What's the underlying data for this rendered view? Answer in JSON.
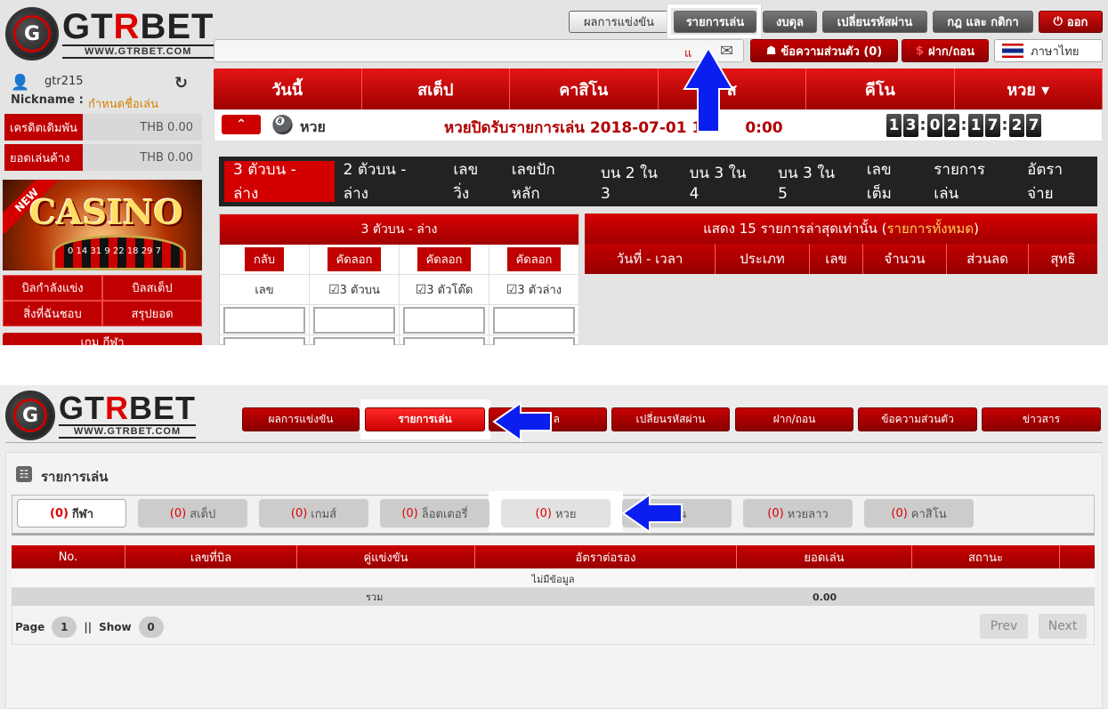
{
  "top": {
    "logo": {
      "name_a": "GT",
      "name_b": "R",
      "name_c": "BET",
      "url": "WWW.GTRBET.COM",
      "mark": "G"
    },
    "header_buttons": {
      "results": "ผลการแข่งขัน",
      "bets": "รายการเล่น",
      "balance": "งบดุล",
      "change_password": "เปลี่ยนรหัสผ่าน",
      "rules": "กฎ และ กติกา",
      "logout": "ออก"
    },
    "marquee_text": "แ",
    "messages": "ข้อความส่วนตัว (0)",
    "deposit": "ฝาก/ถอน",
    "language": "ภาษาไทย",
    "user": {
      "username": "gtr215",
      "nickname_label": "Nickname :",
      "nickname_value": "กำหนดชื่อเล่น"
    },
    "credit": {
      "label": "เครดิตเดิมพัน",
      "value": "THB 0.00"
    },
    "outstanding": {
      "label": "ยอดเล่นค้าง",
      "value": "THB 0.00"
    },
    "casino_banner": {
      "badge": "NEW",
      "text": "CASINO",
      "wheel_numbers": "0 14 31 9 22 18 29 7"
    },
    "side_menu": [
      "บิลกำลังแข่ง",
      "บิลสเต็ป",
      "สิ่งที่ฉันชอบ",
      "สรุปยอด"
    ],
    "side_bottom": "เกม กีฬา",
    "main_nav": [
      "วันนี้",
      "สเต็ป",
      "คาสิโน",
      "ส",
      "คีโน",
      "หวย ▾"
    ],
    "lotto_label": "หวย",
    "close_text": "หวยปิดรับรายการเล่น 2018-07-01 1",
    "close_time_tail": "0:00",
    "countdown": [
      "1",
      "3",
      ":",
      "0",
      "2",
      ":",
      "1",
      "7",
      ":",
      "2",
      "7"
    ],
    "lotto_tabs": [
      "3 ตัวบน - ล่าง",
      "2 ตัวบน - ล่าง",
      "เลขวิ่ง",
      "เลขปักหลัก",
      "บน 2 ใน 3",
      "บน 3 ใน 4",
      "บน 3 ใน 5",
      "เลขเต็ม",
      "รายการเล่น",
      "อัตราจ่าย"
    ],
    "form": {
      "title": "3 ตัวบน - ล่าง",
      "buttons": [
        "กลับ",
        "คัดลอก",
        "คัดลอก",
        "คัดลอก"
      ],
      "number_label": "เลข",
      "checks": [
        "3 ตัวบน",
        "3 ตัวโต๊ด",
        "3 ตัวล่าง"
      ]
    },
    "recent": {
      "title": "แสดง 15 รายการล่าสุดเท่านั้น (",
      "link": "รายการทั้งหมด",
      "title_end": ")",
      "columns": [
        "วันที่ - เวลา",
        "ประเภท",
        "เลข",
        "จำนวน",
        "ส่วนลด",
        "สุทธิ"
      ]
    }
  },
  "bottom": {
    "nav": [
      "ผลการแข่งขัน",
      "รายการเล่น",
      "ล",
      "เปลี่ยนรหัสผ่าน",
      "ฝาก/ถอน",
      "ข้อความส่วนตัว",
      "ข่าวสาร"
    ],
    "section_title": "รายการเล่น",
    "tabs": [
      {
        "count": "(0)",
        "label": "กีฬา"
      },
      {
        "count": "(0)",
        "label": "สเต็ป"
      },
      {
        "count": "(0)",
        "label": "เกมส์"
      },
      {
        "count": "(0)",
        "label": "ล็อตเตอรี่"
      },
      {
        "count": "(0)",
        "label": "หวย"
      },
      {
        "count": "",
        "label": "หุ้น"
      },
      {
        "count": "(0)",
        "label": "หวยลาว"
      },
      {
        "count": "(0)",
        "label": "คาสิโน"
      }
    ],
    "table_headers": [
      "No.",
      "เลขที่บิล",
      "คู่แข่งขัน",
      "อัตราต่อรอง",
      "ยอดเล่น",
      "สถานะ"
    ],
    "no_data": "ไม่มีข้อมูล",
    "total_label": "รวม",
    "total_value": "0.00",
    "pager": {
      "page_label": "Page",
      "page": "1",
      "sep": "||",
      "show_label": "Show",
      "show": "0",
      "prev": "Prev",
      "next": "Next"
    }
  },
  "colors": {
    "accent_red": "#c00000",
    "arrow_blue": "#0a1ef0"
  }
}
